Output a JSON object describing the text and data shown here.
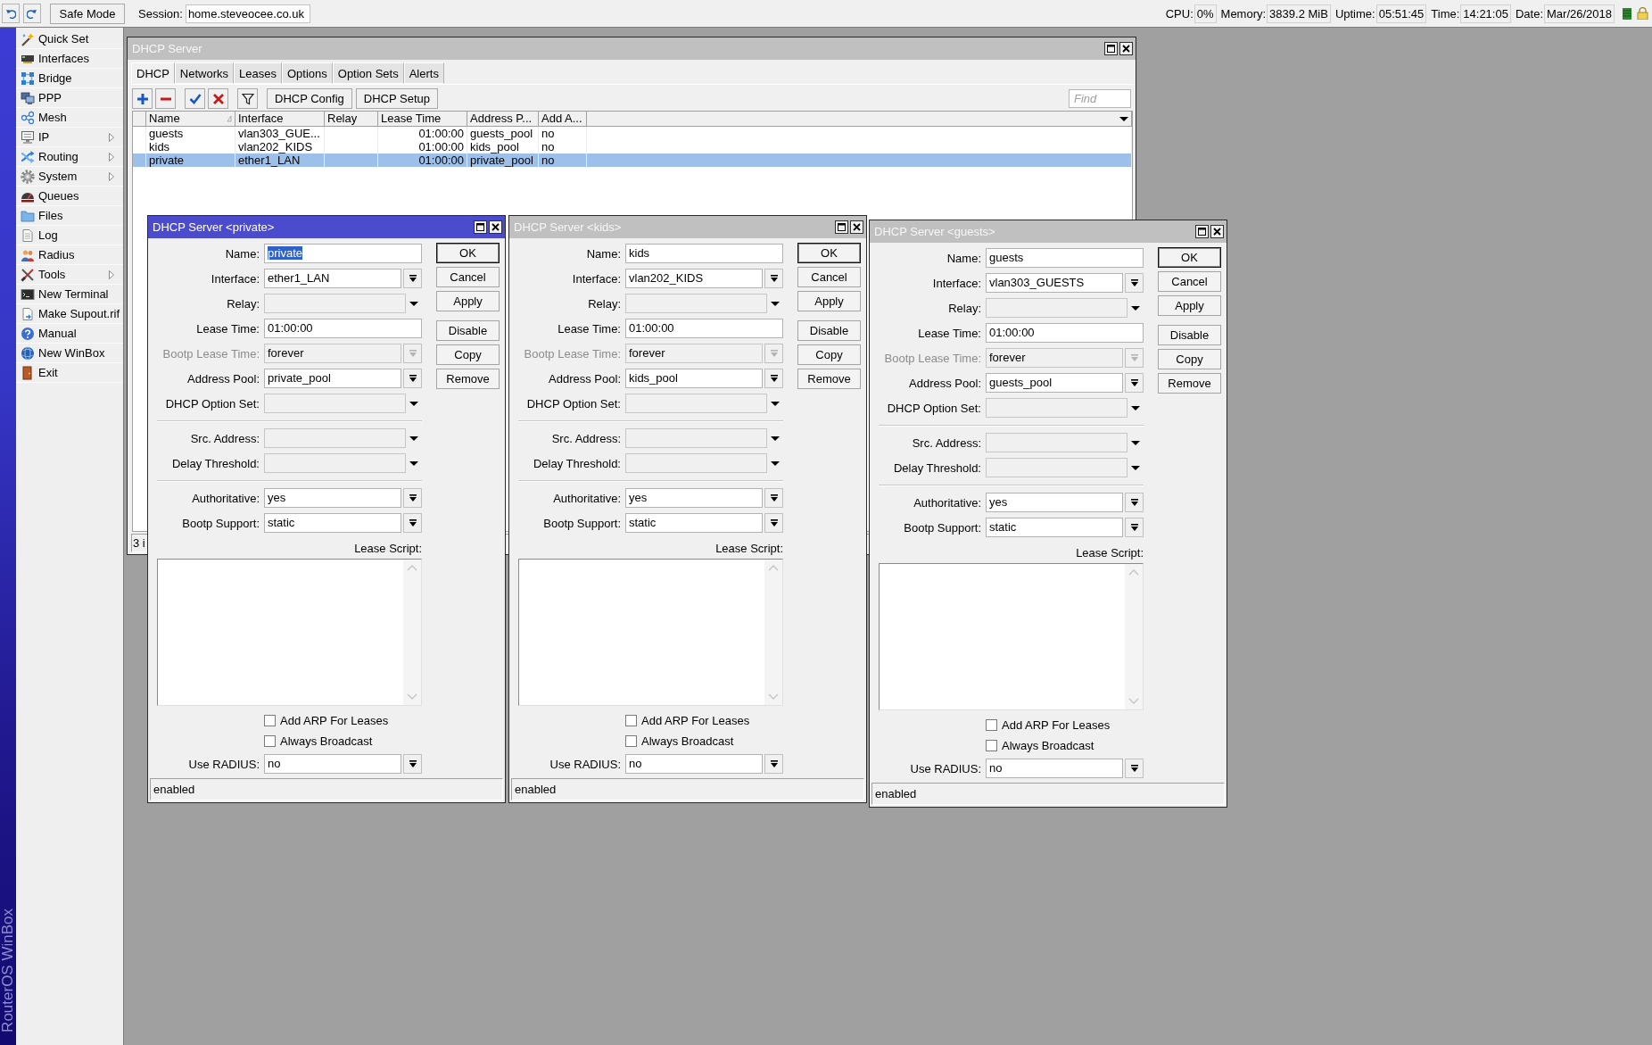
{
  "top_bar": {
    "safe_mode": "Safe Mode",
    "session": {
      "label": "Session:",
      "value": "home.steveocee.co.uk"
    },
    "stats": [
      {
        "label": "CPU:",
        "value": "0%"
      },
      {
        "label": "Memory:",
        "value": "3839.2 MiB"
      },
      {
        "label": "Uptime:",
        "value": "05:51:45"
      },
      {
        "label": "Time:",
        "value": "14:21:05"
      },
      {
        "label": "Date:",
        "value": "Mar/26/2018"
      }
    ]
  },
  "sidebar": {
    "brand": "RouterOS WinBox",
    "items": [
      {
        "label": "Quick Set",
        "submenu": false
      },
      {
        "label": "Interfaces",
        "submenu": false
      },
      {
        "label": "Bridge",
        "submenu": false
      },
      {
        "label": "PPP",
        "submenu": false
      },
      {
        "label": "Mesh",
        "submenu": false
      },
      {
        "label": "IP",
        "submenu": true
      },
      {
        "label": "Routing",
        "submenu": true
      },
      {
        "label": "System",
        "submenu": true
      },
      {
        "label": "Queues",
        "submenu": false
      },
      {
        "label": "Files",
        "submenu": false
      },
      {
        "label": "Log",
        "submenu": false
      },
      {
        "label": "Radius",
        "submenu": false
      },
      {
        "label": "Tools",
        "submenu": true
      },
      {
        "label": "New Terminal",
        "submenu": false
      },
      {
        "label": "Make Supout.rif",
        "submenu": false
      },
      {
        "label": "Manual",
        "submenu": false
      },
      {
        "label": "New WinBox",
        "submenu": false
      },
      {
        "label": "Exit",
        "submenu": false
      }
    ]
  },
  "dhcp_window": {
    "title": "DHCP Server",
    "active": false,
    "tabs": [
      {
        "label": "DHCP",
        "selected": true
      },
      {
        "label": "Networks",
        "selected": false
      },
      {
        "label": "Leases",
        "selected": false
      },
      {
        "label": "Options",
        "selected": false
      },
      {
        "label": "Option Sets",
        "selected": false
      },
      {
        "label": "Alerts",
        "selected": false
      }
    ],
    "toolbar_buttons": [
      "DHCP Config",
      "DHCP Setup"
    ],
    "find": {
      "placeholder": "Find"
    },
    "table": {
      "columns": [
        "Name",
        "Interface",
        "Relay",
        "Lease Time",
        "Address P...",
        "Add A..."
      ],
      "rows": [
        {
          "name": "guests",
          "interface": "vlan303_GUE...",
          "lease_time": "01:00:00",
          "address_pool": "guests_pool",
          "add_arp": "no",
          "selected": false
        },
        {
          "name": "kids",
          "interface": "vlan202_KIDS",
          "lease_time": "01:00:00",
          "address_pool": "kids_pool",
          "add_arp": "no",
          "selected": false
        },
        {
          "name": "private",
          "interface": "ether1_LAN",
          "lease_time": "01:00:00",
          "address_pool": "private_pool",
          "add_arp": "no",
          "selected": true
        }
      ]
    },
    "status_bar": "3 i"
  },
  "dialogs": [
    {
      "title": "DHCP Server <private>",
      "active": true,
      "field_groups": [
        [
          {
            "label": "Name:",
            "kind": "text",
            "value": "private",
            "value_selected": true,
            "disabled": false
          },
          {
            "label": "Interface:",
            "kind": "select",
            "value": "ether1_LAN",
            "value_selected": false,
            "disabled": false
          },
          {
            "label": "Relay:",
            "kind": "combo",
            "disabled": false
          },
          {
            "label": "Lease Time:",
            "kind": "text",
            "value": "01:00:00",
            "value_selected": false,
            "disabled": false
          },
          {
            "label": "Bootp Lease Time:",
            "kind": "select",
            "value": "forever",
            "value_selected": false,
            "disabled": true
          },
          {
            "label": "Address Pool:",
            "kind": "select",
            "value": "private_pool",
            "value_selected": false,
            "disabled": false
          },
          {
            "label": "DHCP Option Set:",
            "kind": "combo",
            "disabled": false
          }
        ],
        [
          {
            "label": "Src. Address:",
            "kind": "combo",
            "disabled": false
          },
          {
            "label": "Delay Threshold:",
            "kind": "combo",
            "disabled": false
          }
        ],
        [
          {
            "label": "Authoritative:",
            "kind": "select",
            "value": "yes",
            "value_selected": false,
            "disabled": false
          },
          {
            "label": "Bootp Support:",
            "kind": "select",
            "value": "static",
            "value_selected": false,
            "disabled": false
          }
        ]
      ],
      "lease_script": {
        "label": "Lease Script:"
      },
      "checkboxes": [
        {
          "label": "Add ARP For Leases",
          "checked": false
        },
        {
          "label": "Always Broadcast",
          "checked": false
        }
      ],
      "use_radius": {
        "label": "Use RADIUS:",
        "kind": "select",
        "value": "no",
        "value_selected": false,
        "disabled": false
      },
      "button_groups": [
        [
          {
            "label": "OK",
            "default": true
          },
          {
            "label": "Cancel",
            "default": false
          },
          {
            "label": "Apply",
            "default": false
          }
        ],
        [
          {
            "label": "Disable",
            "default": false
          },
          {
            "label": "Copy",
            "default": false
          },
          {
            "label": "Remove",
            "default": false
          }
        ]
      ],
      "status": "enabled"
    },
    {
      "title": "DHCP Server <kids>",
      "active": false,
      "field_groups": [
        [
          {
            "label": "Name:",
            "kind": "text",
            "value": "kids",
            "value_selected": false,
            "disabled": false
          },
          {
            "label": "Interface:",
            "kind": "select",
            "value": "vlan202_KIDS",
            "value_selected": false,
            "disabled": false
          },
          {
            "label": "Relay:",
            "kind": "combo",
            "disabled": false
          },
          {
            "label": "Lease Time:",
            "kind": "text",
            "value": "01:00:00",
            "value_selected": false,
            "disabled": false
          },
          {
            "label": "Bootp Lease Time:",
            "kind": "select",
            "value": "forever",
            "value_selected": false,
            "disabled": true
          },
          {
            "label": "Address Pool:",
            "kind": "select",
            "value": "kids_pool",
            "value_selected": false,
            "disabled": false
          },
          {
            "label": "DHCP Option Set:",
            "kind": "combo",
            "disabled": false
          }
        ],
        [
          {
            "label": "Src. Address:",
            "kind": "combo",
            "disabled": false
          },
          {
            "label": "Delay Threshold:",
            "kind": "combo",
            "disabled": false
          }
        ],
        [
          {
            "label": "Authoritative:",
            "kind": "select",
            "value": "yes",
            "value_selected": false,
            "disabled": false
          },
          {
            "label": "Bootp Support:",
            "kind": "select",
            "value": "static",
            "value_selected": false,
            "disabled": false
          }
        ]
      ],
      "lease_script": {
        "label": "Lease Script:"
      },
      "checkboxes": [
        {
          "label": "Add ARP For Leases",
          "checked": false
        },
        {
          "label": "Always Broadcast",
          "checked": false
        }
      ],
      "use_radius": {
        "label": "Use RADIUS:",
        "kind": "select",
        "value": "no",
        "value_selected": false,
        "disabled": false
      },
      "button_groups": [
        [
          {
            "label": "OK",
            "default": true
          },
          {
            "label": "Cancel",
            "default": false
          },
          {
            "label": "Apply",
            "default": false
          }
        ],
        [
          {
            "label": "Disable",
            "default": false
          },
          {
            "label": "Copy",
            "default": false
          },
          {
            "label": "Remove",
            "default": false
          }
        ]
      ],
      "status": "enabled"
    },
    {
      "title": "DHCP Server <guests>",
      "active": false,
      "field_groups": [
        [
          {
            "label": "Name:",
            "kind": "text",
            "value": "guests",
            "value_selected": false,
            "disabled": false
          },
          {
            "label": "Interface:",
            "kind": "select",
            "value": "vlan303_GUESTS",
            "value_selected": false,
            "disabled": false
          },
          {
            "label": "Relay:",
            "kind": "combo",
            "disabled": false
          },
          {
            "label": "Lease Time:",
            "kind": "text",
            "value": "01:00:00",
            "value_selected": false,
            "disabled": false
          },
          {
            "label": "Bootp Lease Time:",
            "kind": "select",
            "value": "forever",
            "value_selected": false,
            "disabled": true
          },
          {
            "label": "Address Pool:",
            "kind": "select",
            "value": "guests_pool",
            "value_selected": false,
            "disabled": false
          },
          {
            "label": "DHCP Option Set:",
            "kind": "combo",
            "disabled": false
          }
        ],
        [
          {
            "label": "Src. Address:",
            "kind": "combo",
            "disabled": false
          },
          {
            "label": "Delay Threshold:",
            "kind": "combo",
            "disabled": false
          }
        ],
        [
          {
            "label": "Authoritative:",
            "kind": "select",
            "value": "yes",
            "value_selected": false,
            "disabled": false
          },
          {
            "label": "Bootp Support:",
            "kind": "select",
            "value": "static",
            "value_selected": false,
            "disabled": false
          }
        ]
      ],
      "lease_script": {
        "label": "Lease Script:"
      },
      "checkboxes": [
        {
          "label": "Add ARP For Leases",
          "checked": false
        },
        {
          "label": "Always Broadcast",
          "checked": false
        }
      ],
      "use_radius": {
        "label": "Use RADIUS:",
        "kind": "select",
        "value": "no",
        "value_selected": false,
        "disabled": false
      },
      "button_groups": [
        [
          {
            "label": "OK",
            "default": true
          },
          {
            "label": "Cancel",
            "default": false
          },
          {
            "label": "Apply",
            "default": false
          }
        ],
        [
          {
            "label": "Disable",
            "default": false
          },
          {
            "label": "Copy",
            "default": false
          },
          {
            "label": "Remove",
            "default": false
          }
        ]
      ],
      "status": "enabled"
    }
  ]
}
